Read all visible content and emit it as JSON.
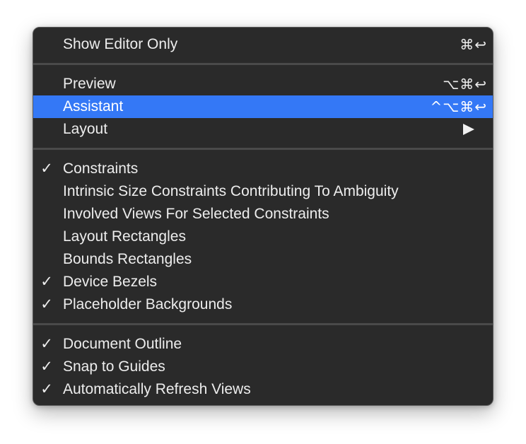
{
  "menu": {
    "items": [
      {
        "label": "Show Editor Only",
        "shortcut": "⌘↩",
        "checked": ""
      },
      {
        "label": "Preview",
        "shortcut": "⌥⌘↩",
        "checked": ""
      },
      {
        "label": "Assistant",
        "shortcut": "^⌥⌘↩",
        "checked": "",
        "highlighted": true
      },
      {
        "label": "Layout",
        "shortcut": "",
        "checked": "",
        "submenu": true
      },
      {
        "label": "Constraints",
        "shortcut": "",
        "checked": "✓"
      },
      {
        "label": "Intrinsic Size Constraints Contributing To Ambiguity",
        "shortcut": "",
        "checked": ""
      },
      {
        "label": "Involved Views For Selected Constraints",
        "shortcut": "",
        "checked": ""
      },
      {
        "label": "Layout Rectangles",
        "shortcut": "",
        "checked": ""
      },
      {
        "label": "Bounds Rectangles",
        "shortcut": "",
        "checked": ""
      },
      {
        "label": "Device Bezels",
        "shortcut": "",
        "checked": "✓"
      },
      {
        "label": "Placeholder Backgrounds",
        "shortcut": "",
        "checked": "✓"
      },
      {
        "label": "Document Outline",
        "shortcut": "",
        "checked": "✓"
      },
      {
        "label": "Snap to Guides",
        "shortcut": "",
        "checked": "✓"
      },
      {
        "label": "Automatically Refresh Views",
        "shortcut": "",
        "checked": "✓"
      }
    ],
    "colors": {
      "background": "#2a2a2a",
      "highlight": "#3478f6",
      "text": "#ededed",
      "separator": "#4a4a4a"
    }
  }
}
